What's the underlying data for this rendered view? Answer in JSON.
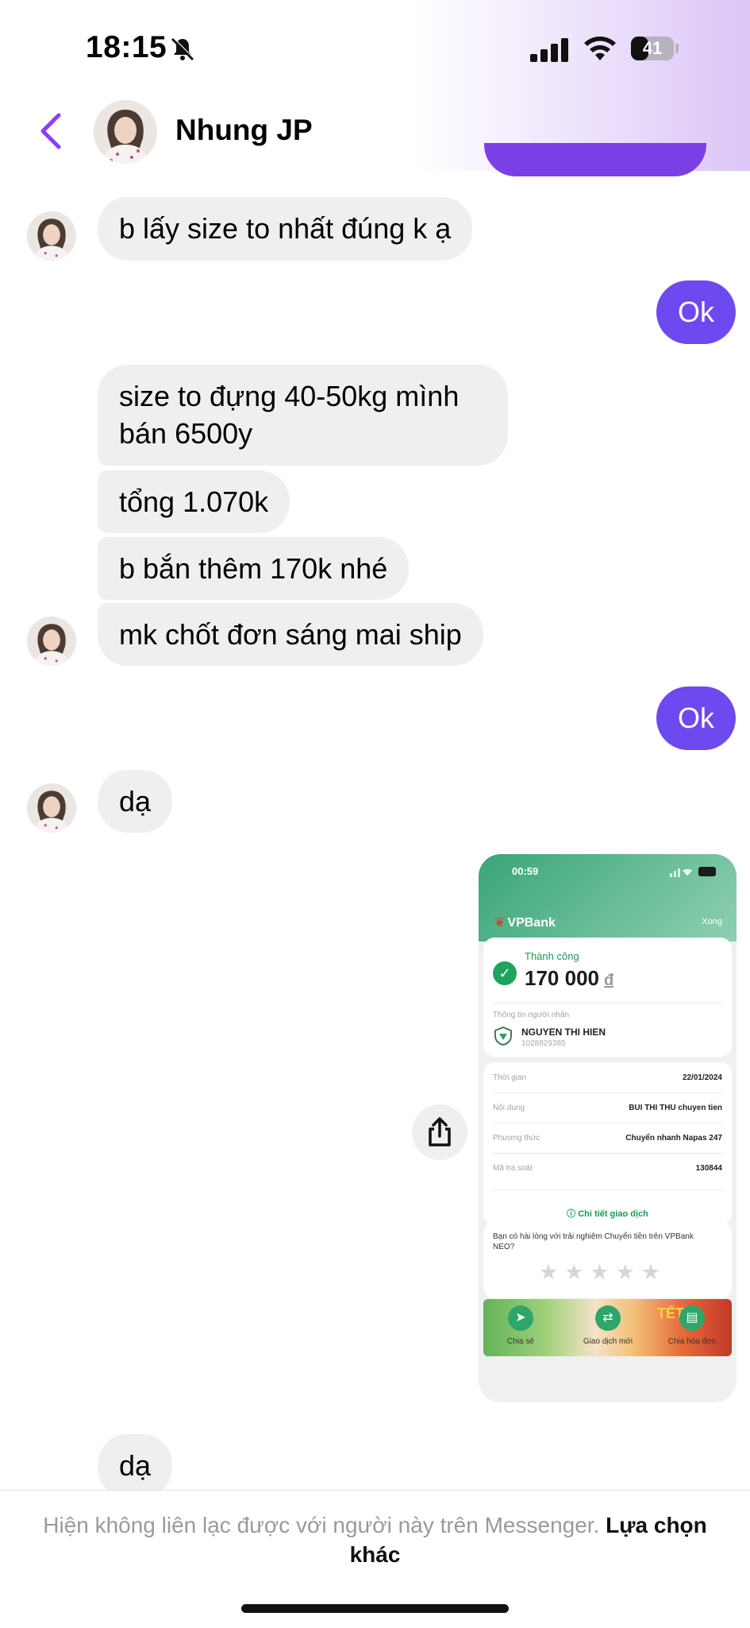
{
  "status_bar": {
    "time": "18:15",
    "battery": "41"
  },
  "header": {
    "contact_name": "Nhung JP"
  },
  "messages": [
    {
      "from": "contact",
      "text": "b lấy size to nhất đúng k ạ"
    },
    {
      "from": "me",
      "text": "Ok"
    },
    {
      "from": "contact",
      "text": "size to đựng 40-50kg mình bán 6500y"
    },
    {
      "from": "contact",
      "text": "tổng 1.070k"
    },
    {
      "from": "contact",
      "text": "b bắn thêm 170k nhé"
    },
    {
      "from": "contact",
      "text": "mk chốt đơn sáng mai ship"
    },
    {
      "from": "me",
      "text": "Ok"
    },
    {
      "from": "contact",
      "text": "dạ"
    },
    {
      "from": "contact",
      "text": "dạ"
    }
  ],
  "receipt": {
    "phone_time": "00:59",
    "bank_logo": "VPBank",
    "done_label": "Xong",
    "status": "Thành công",
    "amount": "170 000",
    "currency": "đ",
    "recipient_label": "Thông tin người nhận",
    "recipient_name": "NGUYEN THI HIEN",
    "recipient_account": "1028829385",
    "rows": [
      {
        "label": "Thời gian",
        "value": "22/01/2024"
      },
      {
        "label": "Nội dung",
        "value": "BUI THI THU chuyen tien"
      },
      {
        "label": "Phương thức",
        "value": "Chuyển nhanh Napas 247"
      },
      {
        "label": "Mã tra soát",
        "value": "130844"
      }
    ],
    "detail_link": "Chi tiết giao dịch",
    "feedback_question": "Bạn có hài lòng với trải nghiệm Chuyển tiền trên VPBank NEO?",
    "banner_text": "TẾT",
    "actions": [
      "Chia sẻ",
      "Giao dịch mới",
      "Chia hóa đơn"
    ]
  },
  "footer": {
    "notice": "Hiện không liên lạc được với người này trên Messenger.",
    "action": "Lựa chọn khác"
  },
  "colors": {
    "accent": "#6d49f0",
    "back_arrow": "#8a3ffc",
    "incoming_bubble": "#efefef",
    "bank_green": "#1fa45d"
  }
}
